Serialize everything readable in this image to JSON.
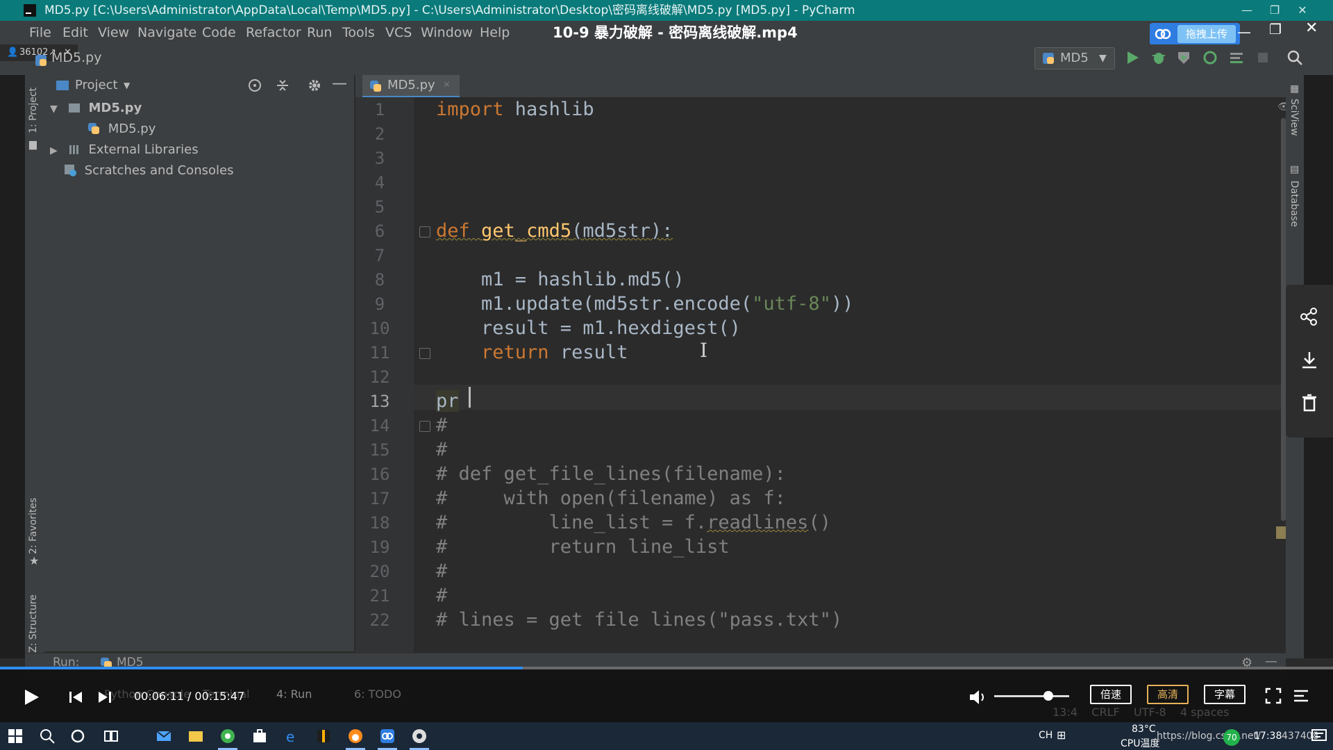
{
  "window": {
    "title": "MD5.py [C:\\Users\\Administrator\\AppData\\Local\\Temp\\MD5.py] - C:\\Users\\Administrator\\Desktop\\密码离线破解\\MD5.py [MD5.py] - PyCharm"
  },
  "overlay": {
    "video_title": "10-9 暴力破解 - 密码离线破解.mp4",
    "counter": "36102",
    "upload_label": "拖拽上传"
  },
  "menu": [
    "File",
    "Edit",
    "View",
    "Navigate",
    "Code",
    "Refactor",
    "Run",
    "Tools",
    "VCS",
    "Window",
    "Help"
  ],
  "nav": {
    "file": "MD5.py",
    "run_config": "MD5"
  },
  "side_tabs": {
    "project": "1: Project",
    "favorites": "2: Favorites",
    "structure": "Z: Structure",
    "sciview": "SciView",
    "database": "Database"
  },
  "project": {
    "header": "Project",
    "tree": [
      {
        "label": "MD5.py",
        "depth": 0,
        "expanded": true,
        "type": "folder"
      },
      {
        "label": "MD5.py",
        "depth": 1,
        "type": "py"
      },
      {
        "label": "External Libraries",
        "depth": 0,
        "expanded": false,
        "type": "lib"
      },
      {
        "label": "Scratches and Consoles",
        "depth": 0,
        "type": "scratch"
      }
    ]
  },
  "editor": {
    "tab_label": "MD5.py",
    "line_numbers": [
      "1",
      "2",
      "3",
      "4",
      "5",
      "6",
      "7",
      "8",
      "9",
      "10",
      "11",
      "12",
      "13",
      "14",
      "15",
      "16",
      "17",
      "18",
      "19",
      "20",
      "21",
      "22"
    ],
    "code": {
      "l1_kw": "import",
      "l1_rest": " hashlib",
      "l6_kw": "def",
      "l6_fn": "get_cmd5",
      "l6_rest": "(md5str):",
      "l8": "    m1 = hashlib.md5()",
      "l9_a": "    m1.update(md5str.encode(",
      "l9_str": "\"utf-8\"",
      "l9_b": "))",
      "l10": "    result = m1.hexdigest()",
      "l11_kw": "    return",
      "l11_rest": " result",
      "l13": "pr",
      "l14": "#",
      "l15": "#",
      "l16": "# def get_file_lines(filename):",
      "l17": "#     with open(filename) as f:",
      "l18_a": "#         line_list = f.",
      "l18_sq": "readlines",
      "l18_b": "()",
      "l19": "#         return line_list",
      "l20": "#",
      "l21": "#",
      "l22": "# lines = get file lines(\"pass.txt\")"
    }
  },
  "run_bar": {
    "run_label": "Run:",
    "run_tab": "MD5",
    "tabs": [
      "Python Console",
      "Terminal",
      "4: Run",
      "6: TODO"
    ]
  },
  "video": {
    "time": "00:06:11 / 00:15:47",
    "progress": 0.392,
    "volume": 0.72,
    "speed_label": "倍速",
    "quality_label": "高清",
    "subtitle_label": "字幕"
  },
  "statusbar": {
    "position": "13:4",
    "line_sep": "CRLF",
    "encoding": "UTF-8",
    "indent": "4 spaces"
  },
  "taskbar": {
    "lang": "CH",
    "cpu_temp": "83°C",
    "cpu_label": "CPU温度",
    "url_text": "https://blog.csdn.net/",
    "time": "17:38",
    "id_suffix": "437408",
    "badge": "70"
  },
  "colors": {
    "titlebar": "#0a7a7a",
    "keyword": "#cc7832",
    "function": "#ffc66d",
    "string": "#6a8759",
    "comment": "#808080",
    "progress": "#2f8ef5"
  }
}
